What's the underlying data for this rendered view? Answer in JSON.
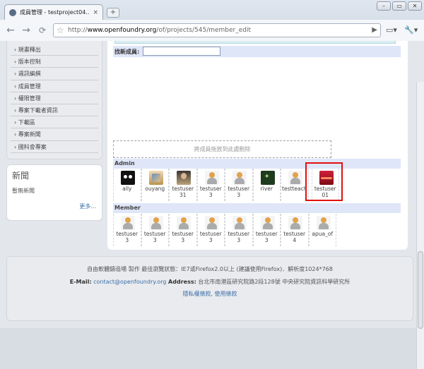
{
  "browser": {
    "tab_title": "成員管理 - testproject04...",
    "tab_close": "×",
    "new_tab": "+",
    "win_min": "–",
    "win_max": "▭",
    "win_close": "✕",
    "url_scheme": "http://",
    "url_domain": "www.openfoundry.org",
    "url_path": "/of/projects/545/member_edit"
  },
  "sidebar": {
    "items": [
      {
        "label": "› 規畫釋出"
      },
      {
        "label": "› 版本控制"
      },
      {
        "label": "› 週訊編撰"
      },
      {
        "label": "› 成員管理"
      },
      {
        "label": "› 權限管理"
      },
      {
        "label": "› 專案下載者資訊"
      },
      {
        "label": "› 下載區"
      },
      {
        "label": "› 專案新聞"
      },
      {
        "label": "› 國科會專案"
      }
    ]
  },
  "news": {
    "heading": "新聞",
    "empty": "暫無新聞",
    "more": "更多..."
  },
  "main": {
    "find_label": "找新成員:",
    "find_value": "",
    "dropzone": "將成員拖放到此處刪除",
    "admin_title": "Admin",
    "admin": [
      {
        "name": "ally",
        "avatar": "ally"
      },
      {
        "name": "ouyang",
        "avatar": "ouyang"
      },
      {
        "name": "testuser31",
        "avatar": "t31"
      },
      {
        "name": "testuser3",
        "avatar": "default"
      },
      {
        "name": "testuser3",
        "avatar": "default"
      },
      {
        "name": "river",
        "avatar": "river"
      },
      {
        "name": "testteach",
        "avatar": "default"
      },
      {
        "name": "testuser01",
        "avatar": "t01"
      }
    ],
    "member_title": "Member",
    "members": [
      {
        "name": "testuser3",
        "avatar": "default"
      },
      {
        "name": "testuser3",
        "avatar": "default"
      },
      {
        "name": "testuser3",
        "avatar": "default"
      },
      {
        "name": "testuser3",
        "avatar": "default"
      },
      {
        "name": "testuser3",
        "avatar": "default"
      },
      {
        "name": "testuser3",
        "avatar": "default"
      },
      {
        "name": "testuser4",
        "avatar": "default"
      },
      {
        "name": "apua_of",
        "avatar": "default"
      }
    ]
  },
  "footer": {
    "line1": "自由軟體鑄造場 製作 最佳瀏覽狀態：IE7或Firefox2.0以上 (建議使用Firefox)．解析度1024*768",
    "email_label": "E-Mail:",
    "email": "contact@openfoundry.org",
    "address_label": "Address:",
    "address": "台北市南港區研究院路2段128號 中央研究院資訊科學研究所",
    "privacy": "隱私權條款",
    "sep": ", ",
    "terms": "使用條款"
  }
}
